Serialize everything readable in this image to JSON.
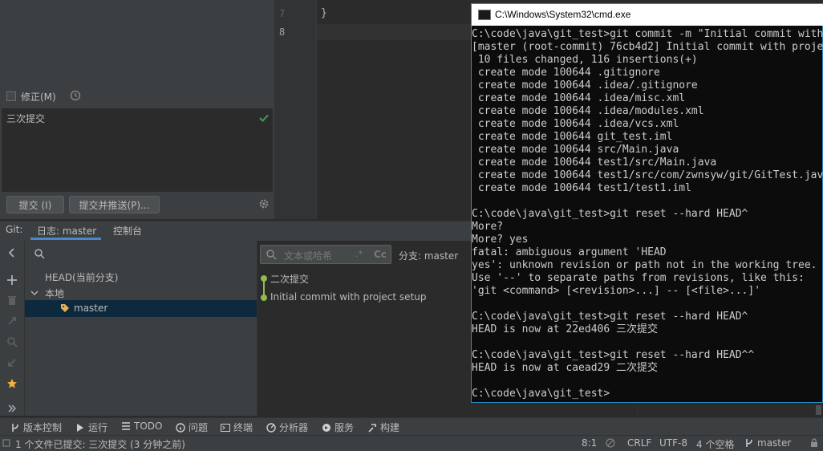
{
  "commit_panel": {
    "amend_label": "修正(M)",
    "commit_message": "三次提交",
    "commit_button": "提交 (I)",
    "commit_push_button": "提交并推送(P)..."
  },
  "editor": {
    "line_numbers": [
      "7",
      "8"
    ],
    "code_line": "}"
  },
  "git_window": {
    "tabs": [
      "Git:",
      "日志: master",
      "控制台"
    ],
    "branches": {
      "head": "HEAD(当前分支)",
      "local_group": "本地",
      "selected_branch": "master"
    },
    "log_filter_placeholder": "文本或哈希",
    "filter_regex": ".*",
    "filter_case": "Cc",
    "branch_filter": "分支: master",
    "commits": [
      "二次提交",
      "Initial commit with project setup"
    ]
  },
  "tool_bar": {
    "items": [
      "版本控制",
      "运行",
      "TODO",
      "问题",
      "终端",
      "分析器",
      "服务",
      "构建"
    ]
  },
  "status_bar": {
    "message": "1 个文件已提交: 三次提交 (3 分钟之前)",
    "position": "8:1",
    "line_ending": "CRLF",
    "encoding": "UTF-8",
    "indent": "4 个空格",
    "branch": "master"
  },
  "cmd": {
    "title": "C:\\Windows\\System32\\cmd.exe",
    "lines": [
      "C:\\code\\java\\git_test>git commit -m \"Initial commit with project setup\"",
      "[master (root-commit) 76cb4d2] Initial commit with project setup",
      " 10 files changed, 116 insertions(+)",
      " create mode 100644 .gitignore",
      " create mode 100644 .idea/.gitignore",
      " create mode 100644 .idea/misc.xml",
      " create mode 100644 .idea/modules.xml",
      " create mode 100644 .idea/vcs.xml",
      " create mode 100644 git_test.iml",
      " create mode 100644 src/Main.java",
      " create mode 100644 test1/src/Main.java",
      " create mode 100644 test1/src/com/zwnsyw/git/GitTest.java",
      " create mode 100644 test1/test1.iml",
      "",
      "C:\\code\\java\\git_test>git reset --hard HEAD^",
      "More?",
      "More? yes",
      "fatal: ambiguous argument 'HEAD",
      "yes': unknown revision or path not in the working tree.",
      "Use '--' to separate paths from revisions, like this:",
      "'git <command> [<revision>...] -- [<file>...]'",
      "",
      "C:\\code\\java\\git_test>git reset --hard HEAD^",
      "HEAD is now at 22ed406 三次提交",
      "",
      "C:\\code\\java\\git_test>git reset --hard HEAD^^",
      "HEAD is now at caead29 二次提交",
      "",
      "C:\\code\\java\\git_test>"
    ]
  }
}
